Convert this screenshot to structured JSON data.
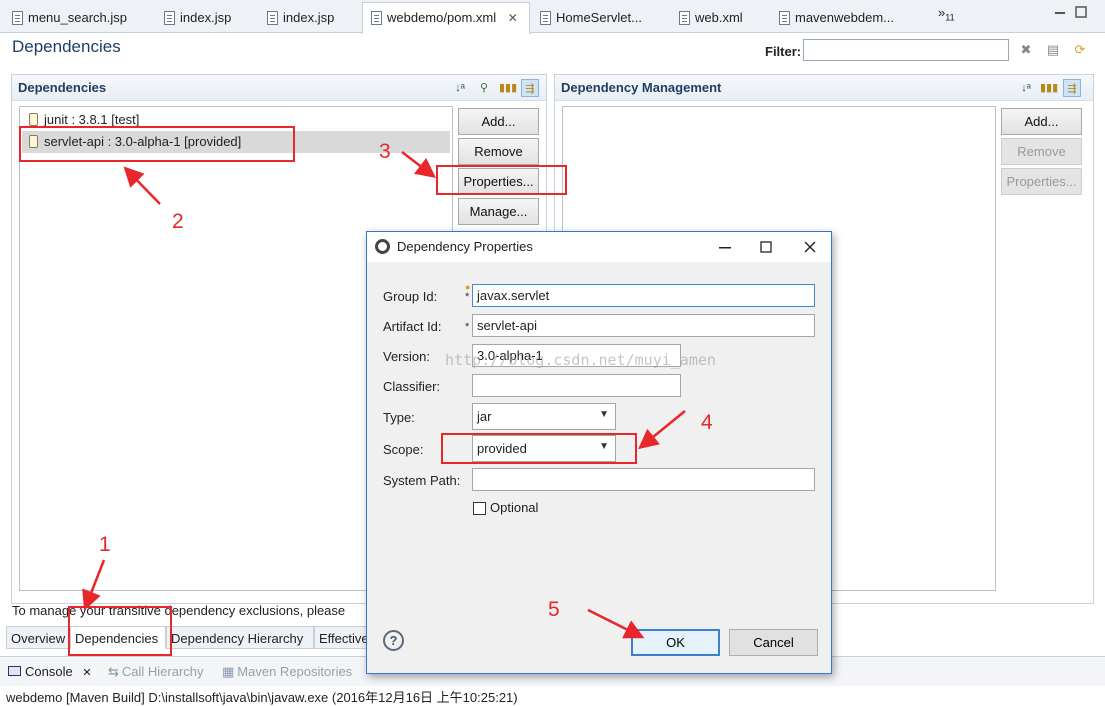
{
  "editor_tabs": [
    {
      "label": "menu_search.jsp"
    },
    {
      "label": "index.jsp"
    },
    {
      "label": "index.jsp"
    },
    {
      "label": "webdemo/pom.xml",
      "close": "✕"
    },
    {
      "label": "HomeServlet..."
    },
    {
      "label": "web.xml"
    },
    {
      "label": "mavenwebdem..."
    }
  ],
  "editor_tabs_overflow": {
    "glyph": "»",
    "count": "11"
  },
  "page": {
    "title": "Dependencies",
    "filter_label": "Filter:",
    "filter_value": ""
  },
  "dependencies": {
    "title": "Dependencies",
    "items": [
      {
        "label": "junit : 3.8.1 [test]"
      },
      {
        "label": "servlet-api : 3.0-alpha-1 [provided]",
        "selected": true
      }
    ],
    "buttons": {
      "add": "Add...",
      "remove": "Remove",
      "properties": "Properties...",
      "manage": "Manage..."
    }
  },
  "dependency_management": {
    "title": "Dependency Management",
    "buttons": {
      "add": "Add...",
      "remove": "Remove",
      "properties": "Properties..."
    }
  },
  "info_text": "To manage your transitive dependency exclusions, please",
  "page_tabs": [
    {
      "label": "Overview"
    },
    {
      "label": "Dependencies",
      "active": true
    },
    {
      "label": "Dependency Hierarchy"
    },
    {
      "label": "Effective"
    }
  ],
  "console": {
    "tabs": [
      {
        "label": "Console",
        "close": "✕"
      },
      {
        "label": "Call Hierarchy"
      },
      {
        "label": "Maven Repositories"
      }
    ],
    "text": "webdemo [Maven Build] D:\\installsoft\\java\\bin\\javaw.exe (2016年12月16日 上午10:25:21)"
  },
  "dialog": {
    "title": "Dependency Properties",
    "fields": {
      "group_id": {
        "label": "Group Id:",
        "value": "javax.servlet"
      },
      "artifact_id": {
        "label": "Artifact Id:",
        "value": "servlet-api"
      },
      "version": {
        "label": "Version:",
        "value": "3.0-alpha-1"
      },
      "classifier": {
        "label": "Classifier:",
        "value": ""
      },
      "type": {
        "label": "Type:",
        "value": "jar"
      },
      "scope": {
        "label": "Scope:",
        "value": "provided"
      },
      "system_path": {
        "label": "System Path:",
        "value": ""
      }
    },
    "required_marker": "*",
    "optional_label": "Optional",
    "optional_checked": false,
    "watermark": "http://blog.csdn.net/muyi_amen",
    "help": "?",
    "ok": "OK",
    "cancel": "Cancel"
  },
  "annotations": [
    "1",
    "2",
    "3",
    "4",
    "5"
  ],
  "colors": {
    "annotation": "#e8262b",
    "dialog_border": "#2b79d8",
    "section_title": "#1f3f62"
  }
}
